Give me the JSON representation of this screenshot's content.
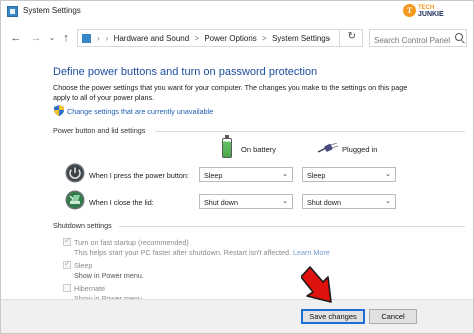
{
  "window": {
    "title": "System Settings"
  },
  "watermark": {
    "logo_letter": "T",
    "line1": "TECH",
    "line2": "JUNKIE"
  },
  "nav": {
    "back_icon": "arrow-left-icon",
    "forward_icon": "arrow-right-icon",
    "recent_icon": "chevron-down-icon",
    "up_icon": "arrow-up-icon"
  },
  "address": {
    "breadcrumbs": [
      "Hardware and Sound",
      "Power Options",
      "System Settings"
    ],
    "separator": ">",
    "refresh_icon": "refresh-icon"
  },
  "search": {
    "placeholder": "Search Control Panel"
  },
  "page": {
    "title": "Define power buttons and turn on password protection",
    "description": "Choose the power settings that you want for your computer. The changes you make to the settings on this page apply to all of your power plans.",
    "change_link": "Change settings that are currently unavailable"
  },
  "power_button_section": {
    "label": "Power button and lid settings",
    "columns": [
      "On battery",
      "Plugged in"
    ],
    "rows": [
      {
        "label": "When I press the power button:",
        "on_battery": "Sleep",
        "plugged_in": "Sleep"
      },
      {
        "label": "When I close the lid:",
        "on_battery": "Shut down",
        "plugged_in": "Shut down"
      }
    ]
  },
  "shutdown_section": {
    "label": "Shutdown settings",
    "items": [
      {
        "label": "Turn on fast startup (recommended)",
        "checked": true,
        "description": "This helps start your PC faster after shutdown. Restart isn't affected.",
        "link": "Learn More"
      },
      {
        "label": "Sleep",
        "checked": true,
        "description": "Show in Power menu."
      },
      {
        "label": "Hibernate",
        "checked": false,
        "description": "Show in Power menu."
      }
    ]
  },
  "footer": {
    "save_label": "Save changes",
    "cancel_label": "Cancel"
  },
  "colors": {
    "title_blue": "#1e4fa0",
    "link_blue": "#1e5fb4",
    "arrow_red": "#e0120e",
    "focus_blue": "#1e6fd4"
  }
}
